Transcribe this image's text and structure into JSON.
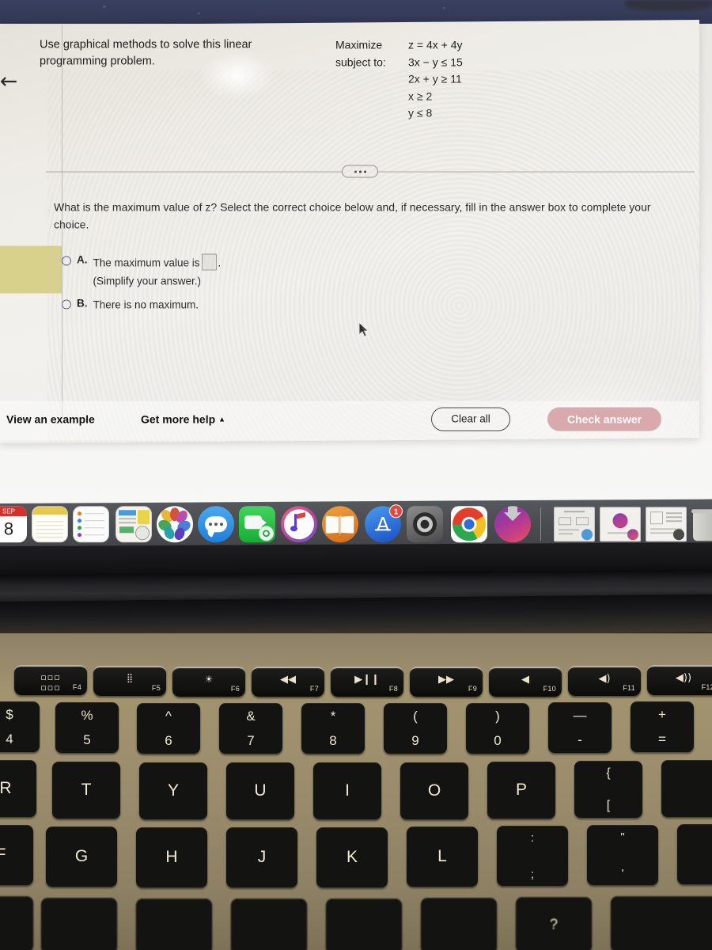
{
  "problem": {
    "instruction": "Use graphical methods to solve this linear programming problem.",
    "objective_label": "Maximize",
    "objective": "z = 4x + 4y",
    "constraints_label": "subject to:",
    "constraints": [
      "3x − y ≤ 15",
      "2x + y ≥ 11",
      "x ≥ 2",
      "y ≤ 8"
    ]
  },
  "question": {
    "prompt": "What is the maximum value of z? Select the correct choice below and, if necessary, fill in the answer box to complete your choice.",
    "choices": [
      {
        "letter": "A.",
        "text_before": "The maximum value is",
        "text_after": ".",
        "answer_value": "",
        "hint": "(Simplify your answer.)",
        "selected": false
      },
      {
        "letter": "B.",
        "text_before": "There is no maximum.",
        "text_after": "",
        "answer_value": "",
        "hint": "",
        "selected": false
      }
    ]
  },
  "actions": {
    "view_example": "View an example",
    "get_more_help": "Get more help",
    "get_more_help_caret": "▲",
    "clear_all": "Clear all",
    "check_answer": "Check answer",
    "check_answer_color": "#d8a9ad"
  },
  "divider": {
    "dots": "•••"
  },
  "back_arrow": "←",
  "dock": {
    "items": [
      {
        "name": "calendar",
        "label": "Calendar",
        "month": "SEP",
        "day": "8",
        "running": false
      },
      {
        "name": "notes",
        "label": "Notes",
        "running": false
      },
      {
        "name": "reminders",
        "label": "Reminders",
        "running": false
      },
      {
        "name": "news",
        "label": "News",
        "running": true
      },
      {
        "name": "photos",
        "label": "Photos",
        "running": false
      },
      {
        "name": "messages",
        "label": "Messages",
        "running": false
      },
      {
        "name": "facetime",
        "label": "FaceTime",
        "running": false
      },
      {
        "name": "itunes",
        "label": "iTunes",
        "running": false
      },
      {
        "name": "ibooks",
        "label": "iBooks",
        "running": false
      },
      {
        "name": "app-store",
        "label": "App Store",
        "badge": "1",
        "running": false
      },
      {
        "name": "system-preferences",
        "label": "System Preferences",
        "running": true
      },
      {
        "name": "google-chrome",
        "label": "Google Chrome",
        "running": true
      },
      {
        "name": "downloads-stack",
        "label": "Downloads",
        "running": true
      }
    ],
    "minimized": [
      {
        "name": "minimized-window-1",
        "label": "Document window"
      },
      {
        "name": "minimized-window-2",
        "label": "Preview window"
      },
      {
        "name": "minimized-window-3",
        "label": "Document window"
      }
    ],
    "trash": {
      "name": "trash",
      "label": "Trash"
    }
  },
  "keyboard": {
    "function_row": [
      {
        "key": "F4",
        "glyph": "☷",
        "name": "launchpad"
      },
      {
        "key": "F5",
        "glyph": "☀",
        "name": "keyboard-brightness-down"
      },
      {
        "key": "F6",
        "glyph": "☀",
        "name": "keyboard-brightness-up"
      },
      {
        "key": "F7",
        "glyph": "◀◀",
        "name": "previous-track"
      },
      {
        "key": "F8",
        "glyph": "▶Ⅱ",
        "name": "play-pause"
      },
      {
        "key": "F9",
        "glyph": "▶▶",
        "name": "next-track"
      },
      {
        "key": "F10",
        "glyph": "◂",
        "name": "mute"
      },
      {
        "key": "F11",
        "glyph": "◂)",
        "name": "volume-down"
      },
      {
        "key": "F12",
        "glyph": "◂))",
        "name": "volume-up"
      }
    ],
    "number_row": [
      {
        "top": "$",
        "bottom": "4"
      },
      {
        "top": "%",
        "bottom": "5"
      },
      {
        "top": "^",
        "bottom": "6"
      },
      {
        "top": "&",
        "bottom": "7"
      },
      {
        "top": "*",
        "bottom": "8"
      },
      {
        "top": "(",
        "bottom": "9"
      },
      {
        "top": ")",
        "bottom": "0"
      },
      {
        "top": "—",
        "bottom": "-"
      },
      {
        "top": "+",
        "bottom": "="
      }
    ],
    "letter_row_1": [
      "R",
      "T",
      "Y",
      "U",
      "I",
      "O",
      "P",
      "{"
    ],
    "letter_row_1_sub": [
      "",
      "",
      "",
      "",
      "",
      "",
      "",
      "["
    ],
    "letter_row_2": [
      "F",
      "G",
      "H",
      "J",
      "K",
      "L",
      ":",
      "\""
    ],
    "letter_row_2_sub": [
      "",
      "",
      "",
      "",
      "",
      "",
      ";",
      "'"
    ],
    "bottom_row": [
      "",
      "",
      "",
      "",
      "",
      "",
      "?"
    ]
  }
}
